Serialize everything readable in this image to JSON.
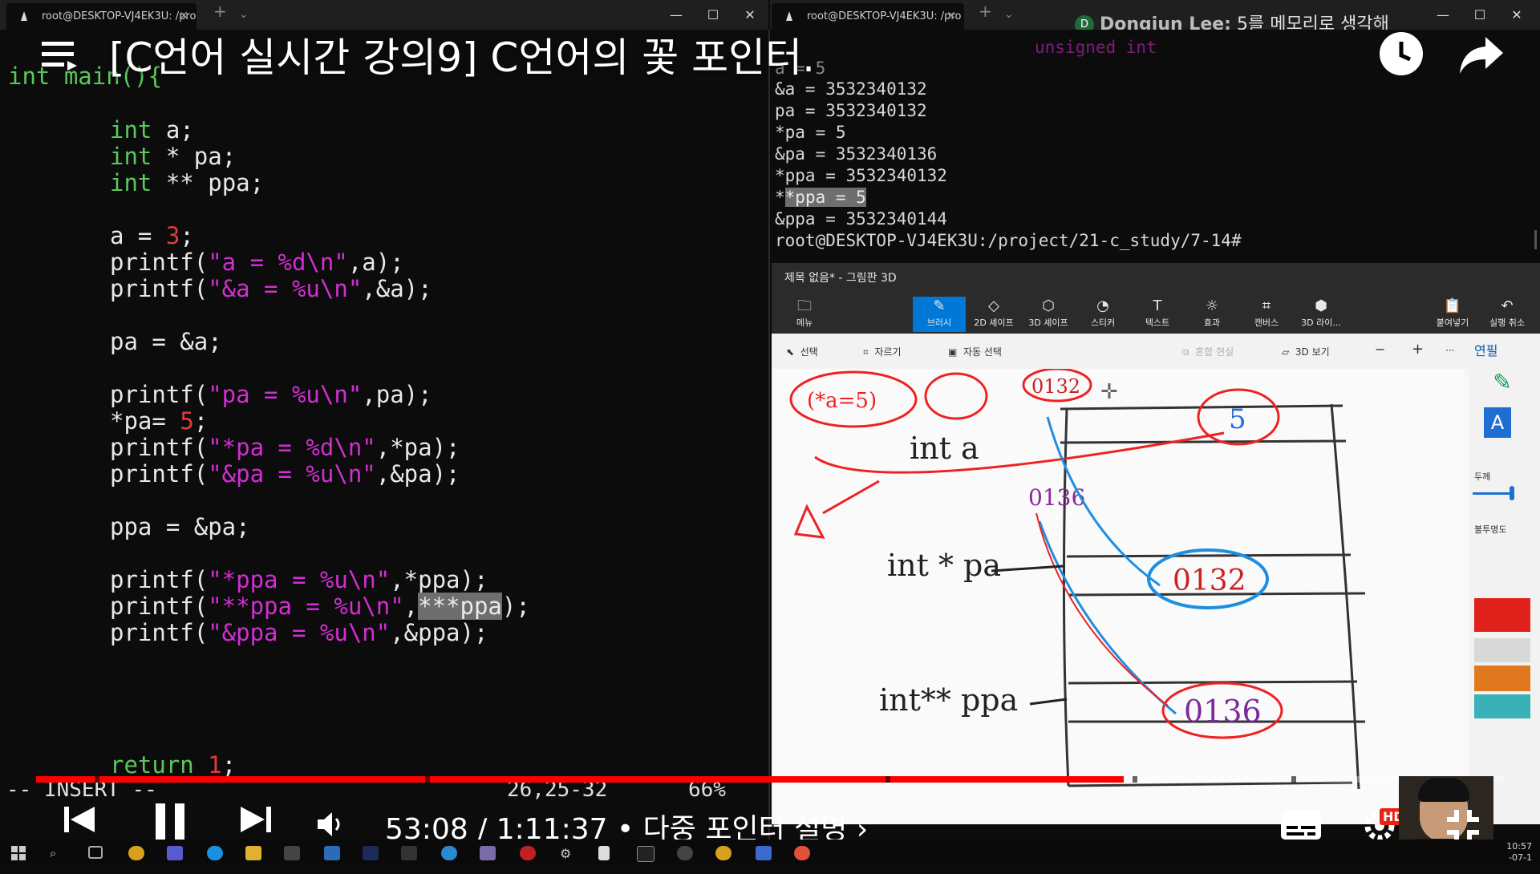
{
  "tabs": [
    {
      "title": "root@DESKTOP-VJ4EK3U: /pro"
    },
    {
      "title": "root@DESKTOP-VJ4EK3U: /pro"
    }
  ],
  "comment": {
    "author": "Dongjun Lee:",
    "text": "5를 메모리로 생각해"
  },
  "video": {
    "title": "[C언어 실시간 강의9] C언어의 꽃 포인터.",
    "time": "53:08 / 1:11:37 • 다중 포인터 설명 ›",
    "progress_fraction": 0.741,
    "hd_badge": "HD"
  },
  "code_lines": {
    "l1": "int main(){",
    "l2_kw": "int",
    "l2_rest": " a;",
    "l3_kw": "int",
    "l3_rest": " * pa;",
    "l4_kw": "int",
    "l4_rest": " ** ppa;",
    "l5_a": "a = ",
    "l5_num": "3",
    "l5_end": ";",
    "l6_a": "printf(",
    "l6_s": "\"a = %d\\n\"",
    "l6_e": ",a);",
    "l7_a": "printf(",
    "l7_s": "\"&a = %u\\n\"",
    "l7_e": ",&a);",
    "l8": "pa = &a;",
    "l9_a": "printf(",
    "l9_s": "\"pa = %u\\n\"",
    "l9_e": ",pa);",
    "l10_a": "*pa= ",
    "l10_num": "5",
    "l10_e": ";",
    "l11_a": "printf(",
    "l11_s": "\"*pa = %d\\n\"",
    "l11_e": ",*pa);",
    "l12_a": "printf(",
    "l12_s": "\"&pa = %u\\n\"",
    "l12_e": ",&pa);",
    "l13": "ppa = &pa;",
    "l14_a": "printf(",
    "l14_s": "\"*ppa = %u\\n\"",
    "l14_e": ",*ppa);",
    "l15_a": "printf(",
    "l15_s": "\"**ppa = %u\\n\"",
    "l15_c": ",",
    "l15_h": "***ppa",
    "l15_e": ");",
    "l16_a": "printf(",
    "l16_s": "\"&ppa = %u\\n\"",
    "l16_e": ",&ppa);",
    "l17_kw": "return",
    "l17_num": "1",
    "l17_e": ";"
  },
  "vim_status": {
    "mode": "-- INSERT --",
    "position": "26,25-32",
    "percent": "66%"
  },
  "terminal_output": {
    "t0": "a = 5",
    "t1": "&a = 3532340132",
    "t2": "pa = 3532340132",
    "t3": "*pa = 5",
    "t4": "&pa = 3532340136",
    "t5": "*ppa = 3532340132",
    "t6a": "*",
    "t6b": "*ppa = 5",
    "t7": "&ppa = 3532340144",
    "t8": "root@DESKTOP-VJ4EK3U:/project/21-c_study/7-14#",
    "ghost": "unsigned int"
  },
  "paint3d": {
    "window_title": "제목 없음* - 그림판 3D",
    "ribbon": [
      "메뉴",
      "브러시",
      "2D 셰이프",
      "3D 셰이프",
      "스티커",
      "텍스트",
      "효과",
      "캔버스",
      "3D 라이...",
      "붙여넣기",
      "실행 취소"
    ],
    "subbar": [
      "선택",
      "자르기",
      "자동 선택",
      "혼합 현실",
      "3D 보기",
      "−",
      "+",
      "···"
    ],
    "side": {
      "title": "연필",
      "thickness": "두께",
      "opacity": "불투명도"
    },
    "drawing": {
      "a_label": "int  a",
      "a_value": "5",
      "a_addr": "0132",
      "pa_label": "int *  pa",
      "pa_value": "0132",
      "pa_addr": "0136",
      "ppa_label": "int**  ppa",
      "ppa_value": "0136",
      "ptr_note": "(*a=5)"
    }
  },
  "taskbar": {
    "time": "10:57",
    "date": "-07-1"
  },
  "colors": {
    "keyword": "#5ac85a",
    "string": "#d22ed2",
    "number": "#e23b3b",
    "progress": "#ff0000",
    "accent": "#0078d7"
  }
}
